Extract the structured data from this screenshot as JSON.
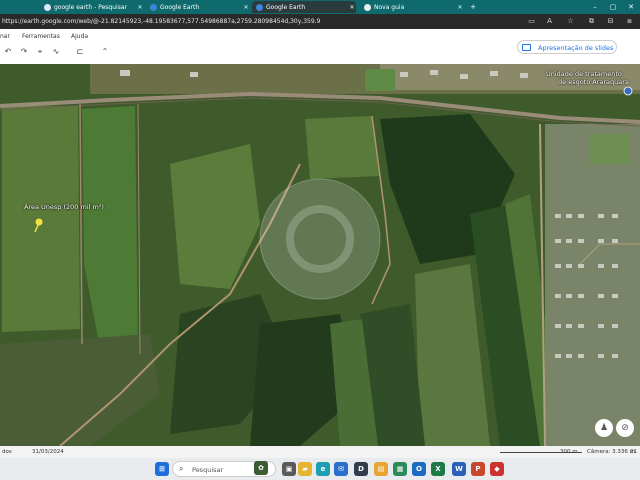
{
  "tabs": [
    {
      "label": "google earth - Pesquisar",
      "active": false,
      "favicon_color": "#dbe7ff"
    },
    {
      "label": "Google Earth",
      "active": false,
      "favicon_color": "#3f86d8"
    },
    {
      "label": "Google Earth",
      "active": true,
      "favicon_color": "#3f86d8"
    },
    {
      "label": "Nova guia",
      "active": false,
      "favicon_color": "#e9eef0"
    }
  ],
  "new_tab_label": "+",
  "address": {
    "url": "https://earth.google.com/web/@-21.82145923,-48.19583677,577.54986887a,2759.28098454d,30y,359.99999996h,0t,0r"
  },
  "menu": {
    "items": [
      "nar",
      "Ferramentas",
      "Ajuda"
    ],
    "present_button": "Apresentação de slides"
  },
  "map": {
    "placemarks": [
      {
        "label": "Área Unesp (200 mil m²)"
      },
      {
        "label_line1": "Unidade de tratamento",
        "label_line2": "de esgoto Araraquara"
      }
    ]
  },
  "status": {
    "left": "dos",
    "date": "31/03/2024",
    "scale": "300 m",
    "camera": "Câmera: 3.336 m",
    "coords": "21"
  },
  "taskbar": {
    "search_placeholder": "Pesquisar"
  },
  "colors": {
    "tabbar": "#0f6a6e",
    "accent_blue": "#1a73e8",
    "placemark_yellow": "#f5e33b"
  },
  "icons": [
    "back-arrow-icon",
    "shield-icon",
    "star-icon",
    "refresh-icon",
    "windows-start-icon",
    "search-icon",
    "file-explorer-icon",
    "edge-icon",
    "mail-icon",
    "dell-icon",
    "word-icon",
    "excel-icon",
    "powerpoint-icon",
    "whatsapp-icon"
  ]
}
